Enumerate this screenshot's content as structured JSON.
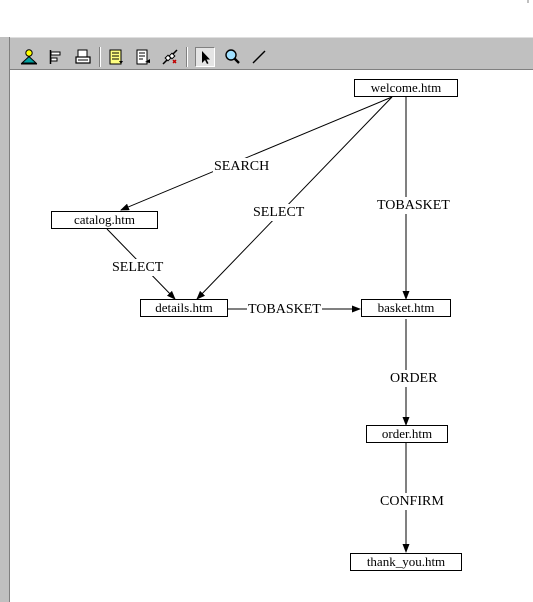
{
  "toolbar": {
    "buttons": [
      {
        "name": "user-icon"
      },
      {
        "name": "align-left-icon"
      },
      {
        "name": "print-icon"
      },
      {
        "name": "notes-icon"
      },
      {
        "name": "document-edit-icon"
      },
      {
        "name": "unlink-icon"
      },
      {
        "name": "select-pointer-icon",
        "pressed": true
      },
      {
        "name": "zoom-icon"
      },
      {
        "name": "draw-line-icon"
      }
    ]
  },
  "diagram": {
    "nodes": {
      "welcome": "welcome.htm",
      "catalog": "catalog.htm",
      "details": "details.htm",
      "basket": "basket.htm",
      "order": "order.htm",
      "thank_you": "thank_you.htm"
    },
    "edges": {
      "search": "SEARCH",
      "select_from_welcome": "SELECT",
      "tobasket_from_welcome": "TOBASKET",
      "select_from_catalog": "SELECT",
      "tobasket_from_details": "TOBASKET",
      "order": "ORDER",
      "confirm": "CONFIRM"
    }
  }
}
